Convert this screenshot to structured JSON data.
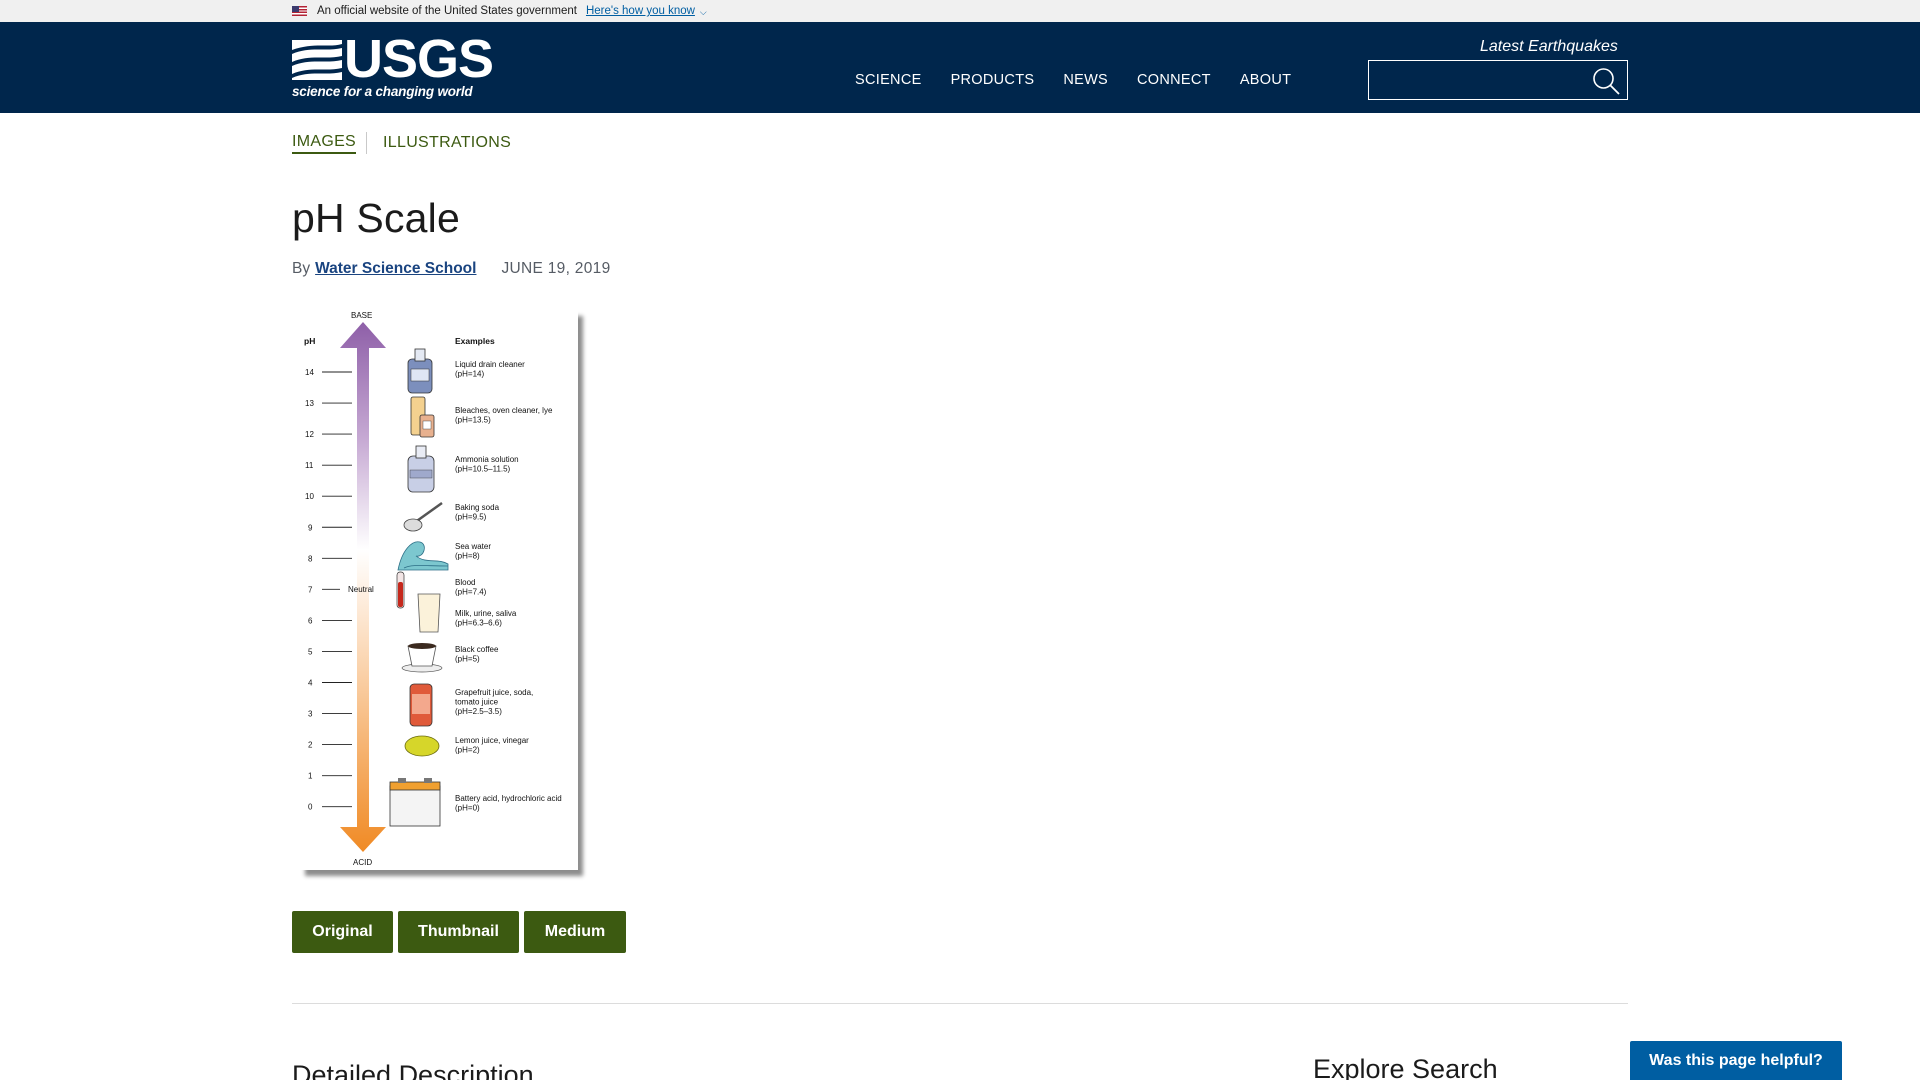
{
  "gov_banner": {
    "text": "An official website of the United States government",
    "link": "Here's how you know"
  },
  "header": {
    "logo_word": "USGS",
    "logo_tagline": "science for a changing world",
    "nav": [
      "SCIENCE",
      "PRODUCTS",
      "NEWS",
      "CONNECT",
      "ABOUT"
    ],
    "quake_link": "Latest Earthquakes",
    "search_placeholder": ""
  },
  "subnav": {
    "items": [
      "IMAGES",
      "ILLUSTRATIONS"
    ],
    "active": "IMAGES"
  },
  "page": {
    "title": "pH Scale",
    "by_prefix": "By",
    "author": "Water Science School",
    "date": "JUNE 19, 2019"
  },
  "figure": {
    "label_base": "BASE",
    "label_acid": "ACID",
    "label_ph": "pH",
    "label_examples": "Examples",
    "label_neutral": "Neutral",
    "ticks": [
      14,
      13,
      12,
      11,
      10,
      9,
      8,
      7,
      6,
      5,
      4,
      3,
      2,
      1,
      0
    ],
    "examples": [
      {
        "lines": [
          "Liquid drain cleaner",
          "(pH=14)"
        ],
        "icon": "jug-icon"
      },
      {
        "lines": [
          "Bleaches, oven cleaner, lye",
          "(pH=13.5)"
        ],
        "icon": "bottles-icon"
      },
      {
        "lines": [
          "Ammonia solution",
          "(pH=10.5–11.5)"
        ],
        "icon": "ammonia-bottle-icon"
      },
      {
        "lines": [
          "Baking soda",
          "(pH=9.5)"
        ],
        "icon": "spoon-icon"
      },
      {
        "lines": [
          "Sea water",
          "(pH=8)"
        ],
        "icon": "wave-icon"
      },
      {
        "lines": [
          "Blood",
          "(pH=7.4)"
        ],
        "icon": "test-tube-icon"
      },
      {
        "lines": [
          "Milk, urine, saliva",
          "(pH=6.3–6.6)"
        ],
        "icon": "glass-icon"
      },
      {
        "lines": [
          "Black coffee",
          "(pH=5)"
        ],
        "icon": "coffee-cup-icon"
      },
      {
        "lines": [
          "Grapefruit juice, soda,",
          "tomato juice",
          "(pH=2.5–3.5)"
        ],
        "icon": "soda-can-icon"
      },
      {
        "lines": [
          "Lemon juice, vinegar",
          "(pH=2)"
        ],
        "icon": "lemon-icon"
      },
      {
        "lines": [
          "Battery acid, hydrochloric acid",
          "(pH=0)"
        ],
        "icon": "battery-icon"
      }
    ],
    "colors": {
      "base": "#8e5fa8",
      "neutral": "#ffffff",
      "acid": "#f08a24"
    }
  },
  "buttons": [
    "Original",
    "Thumbnail",
    "Medium"
  ],
  "sections": {
    "detailed_description": "Detailed Description",
    "explore_search": "Explore Search"
  },
  "feedback_button": "Was this page helpful?"
}
